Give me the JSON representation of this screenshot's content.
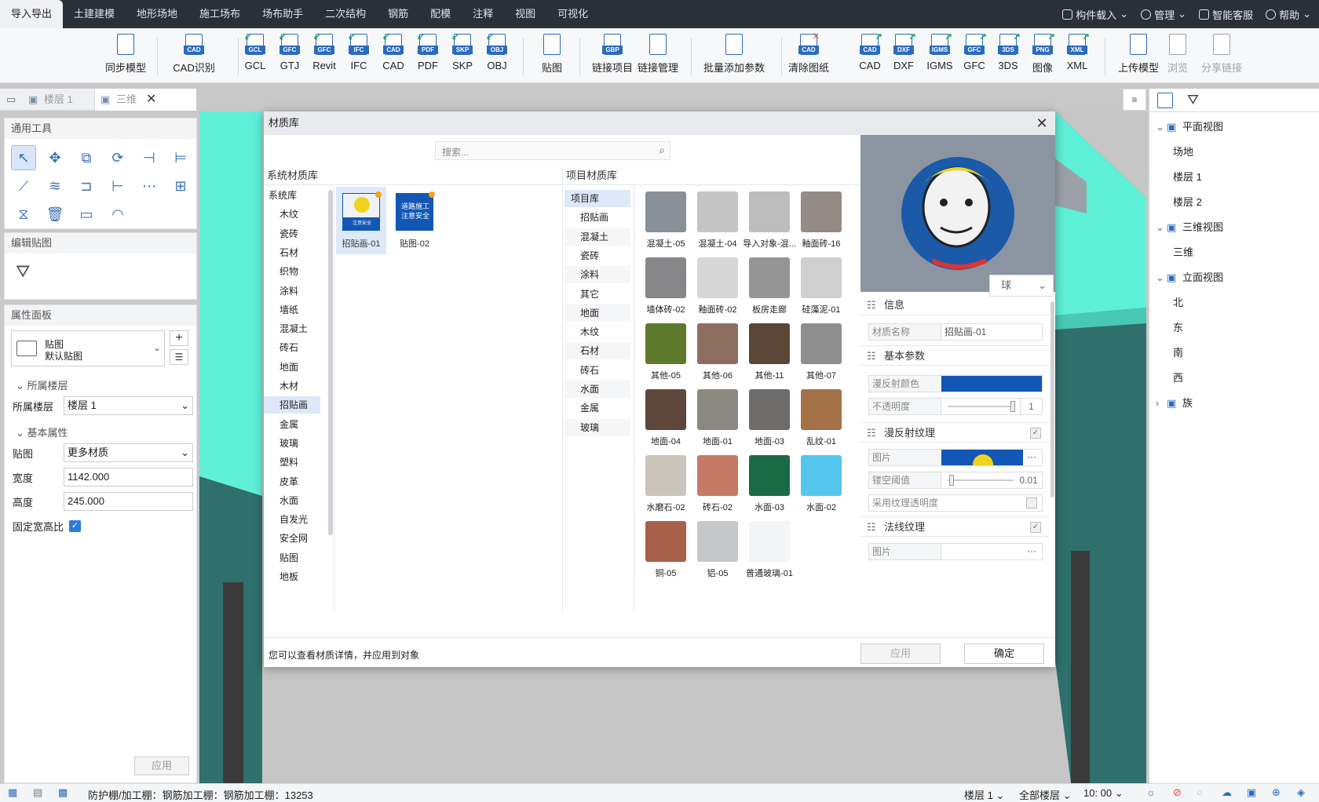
{
  "menu": {
    "tabs": [
      "导入导出",
      "土建建模",
      "地形场地",
      "施工场布",
      "场布助手",
      "二次结构",
      "钢筋",
      "配模",
      "注释",
      "视图",
      "可视化"
    ],
    "right": [
      "构件载入",
      "管理",
      "智能客服",
      "帮助"
    ]
  },
  "ribbon": {
    "buttons": [
      {
        "label": "同步模型",
        "tag": ""
      },
      {
        "label": "CAD识别",
        "tag": "CAD"
      },
      {
        "label": "GCL",
        "tag": "GCL"
      },
      {
        "label": "GTJ",
        "tag": "GFC"
      },
      {
        "label": "Revit",
        "tag": "GFC"
      },
      {
        "label": "IFC",
        "tag": "IFC"
      },
      {
        "label": "CAD",
        "tag": "CAD"
      },
      {
        "label": "PDF",
        "tag": "PDF"
      },
      {
        "label": "SKP",
        "tag": "SKP"
      },
      {
        "label": "OBJ",
        "tag": "OBJ"
      },
      {
        "label": "贴图",
        "tag": ""
      },
      {
        "label": "链接项目",
        "tag": "GBP"
      },
      {
        "label": "链接管理",
        "tag": ""
      },
      {
        "label": "批量添加参数",
        "tag": ""
      },
      {
        "label": "清除图纸",
        "tag": "CAD"
      },
      {
        "label": "CAD",
        "tag": "CAD"
      },
      {
        "label": "DXF",
        "tag": "DXF"
      },
      {
        "label": "IGMS",
        "tag": "IGMS"
      },
      {
        "label": "GFC",
        "tag": "GFC"
      },
      {
        "label": "3DS",
        "tag": "3DS"
      },
      {
        "label": "图像",
        "tag": "PNG"
      },
      {
        "label": "XML",
        "tag": "XML"
      },
      {
        "label": "上传模型",
        "tag": ""
      },
      {
        "label": "浏览",
        "tag": ""
      },
      {
        "label": "分享链接",
        "tag": ""
      }
    ]
  },
  "tabstrip": {
    "tab1": "楼层 1",
    "tab2": "三维"
  },
  "left": {
    "tools_title": "通用工具",
    "edit_title": "编辑贴图",
    "props_title": "属性面板",
    "type_line1": "贴图",
    "type_line2": "默认贴图",
    "floor_section": "所属楼层",
    "floor_label": "所属楼层",
    "floor_value": "楼层 1",
    "basic_section": "基本属性",
    "map_label": "贴图",
    "map_value": "更多材质",
    "width_label": "宽度",
    "width_value": "1142.000",
    "height_label": "高度",
    "height_value": "245.000",
    "ratio_label": "固定宽高比",
    "apply": "应用"
  },
  "dialog": {
    "title": "材质库",
    "search_placeholder": "搜索...",
    "sys_title": "系统材质库",
    "proj_title": "项目材质库",
    "sys_cats": [
      "系统库",
      "木纹",
      "瓷砖",
      "石材",
      "织物",
      "涂料",
      "墙纸",
      "混凝土",
      "砖石",
      "地面",
      "木材",
      "招贴画",
      "金属",
      "玻璃",
      "塑料",
      "皮革",
      "水面",
      "自发光",
      "安全网",
      "贴图",
      "地板"
    ],
    "sys_items": [
      {
        "name": "招贴画-01",
        "sign": "注意安全"
      },
      {
        "name": "贴图-02",
        "sign": "道路施工 注意安全"
      }
    ],
    "proj_cats": [
      "项目库",
      "招贴画",
      "混凝土",
      "瓷砖",
      "涂料",
      "其它",
      "地面",
      "木纹",
      "石材",
      "砖石",
      "水面",
      "金属",
      "玻璃"
    ],
    "swatches": [
      {
        "name": "混凝土-05",
        "color": "#8a9097"
      },
      {
        "name": "混凝土-04",
        "color": "#c4c4c4"
      },
      {
        "name": "导入对象-混...",
        "color": "#bdbdbd"
      },
      {
        "name": "釉面砖-16",
        "color": "#958b86"
      },
      {
        "name": "墙体砖-02",
        "color": "#87878a"
      },
      {
        "name": "釉面砖-02",
        "color": "#d6d6d6"
      },
      {
        "name": "板房走廊",
        "color": "#959595"
      },
      {
        "name": "硅藻泥-01",
        "color": "#cfcfcf"
      },
      {
        "name": "其他-05",
        "color": "#5d7a2c"
      },
      {
        "name": "其他-06",
        "color": "#8d6d5e"
      },
      {
        "name": "其他-11",
        "color": "#5b4737"
      },
      {
        "name": "其他-07",
        "color": "#8f8f8f"
      },
      {
        "name": "地面-04",
        "color": "#5e473c"
      },
      {
        "name": "地面-01",
        "color": "#8c8983"
      },
      {
        "name": "地面-03",
        "color": "#6d6c6a"
      },
      {
        "name": "乱纹-01",
        "color": "#a57248"
      },
      {
        "name": "水磨石-02",
        "color": "#cbc4bb"
      },
      {
        "name": "砖石-02",
        "color": "#c47a66"
      },
      {
        "name": "水面-03",
        "color": "#1a6a45"
      },
      {
        "name": "水面-02",
        "color": "#55c7ee"
      },
      {
        "name": "铜-05",
        "color": "#a8604a"
      },
      {
        "name": "铝-05",
        "color": "#c6c8ca"
      },
      {
        "name": "普通玻璃-01",
        "color": "#f2f6f8"
      }
    ],
    "preview_shape": "球",
    "info_title": "信息",
    "mat_name_label": "材质名称",
    "mat_name_value": "招贴画-01",
    "basic_title": "基本参数",
    "diffuse_color_label": "漫反射颜色",
    "diffuse_color": "#1257b5",
    "opacity_label": "不透明度",
    "opacity_value": "1",
    "diffuse_tex_title": "漫反射纹理",
    "image_label": "图片",
    "threshold_label": "镂空阈值",
    "threshold_value": "0.01",
    "use_alpha_label": "采用纹理透明度",
    "normal_tex_title": "法线纹理",
    "image_label2": "图片",
    "footer_hint": "您可以查看材质详情，并应用到对象",
    "apply": "应用",
    "ok": "确定"
  },
  "tree": {
    "nodes": [
      {
        "label": "平面视图",
        "level": 0
      },
      {
        "label": "场地",
        "level": 1
      },
      {
        "label": "楼层 1",
        "level": 1
      },
      {
        "label": "楼层 2",
        "level": 1
      },
      {
        "label": "三维视图",
        "level": 0
      },
      {
        "label": "三维",
        "level": 1
      },
      {
        "label": "立面视图",
        "level": 0
      },
      {
        "label": "北",
        "level": 1
      },
      {
        "label": "东",
        "level": 1
      },
      {
        "label": "南",
        "level": 1
      },
      {
        "label": "西",
        "level": 1
      },
      {
        "label": "族",
        "level": 0
      }
    ]
  },
  "status": {
    "path": "防护棚/加工棚：钢筋加工棚：钢筋加工棚：13253",
    "floor": "楼层 1",
    "all_floors": "全部楼层",
    "time": "10: 00"
  },
  "colors": {
    "accent": "#1257b5",
    "cyan": "#5ff0d8",
    "teal": "#2b6a6a"
  }
}
